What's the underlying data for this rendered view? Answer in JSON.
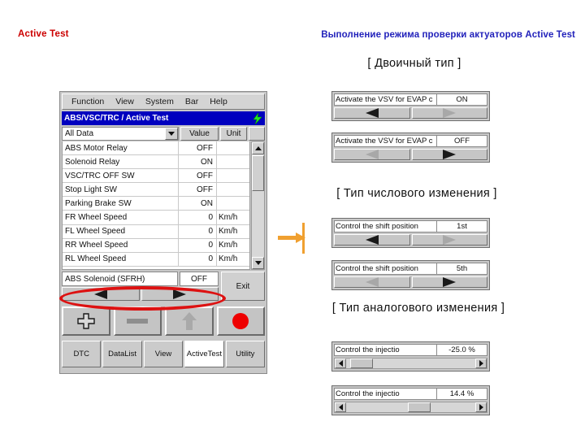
{
  "header": {
    "left_label": "Active Test",
    "right_label": "Выполнение режима проверки актуаторов Active Test",
    "left_color": "#cc0000",
    "right_color": "#2222bb"
  },
  "device": {
    "menu": [
      "Function",
      "View",
      "System",
      "Bar",
      "Help"
    ],
    "title": "ABS/VSC/TRC / Active Test",
    "title_bg": "#0000bf",
    "bolt_icon": "lightning-bolt-icon",
    "filter": {
      "value": "All Data"
    },
    "columns": [
      "Value",
      "Unit"
    ],
    "rows": [
      {
        "name": "ABS Motor Relay",
        "value": "OFF",
        "unit": ""
      },
      {
        "name": "Solenoid Relay",
        "value": "ON",
        "unit": ""
      },
      {
        "name": "VSC/TRC OFF SW",
        "value": "OFF",
        "unit": ""
      },
      {
        "name": "Stop Light SW",
        "value": "OFF",
        "unit": ""
      },
      {
        "name": "Parking Brake SW",
        "value": "ON",
        "unit": ""
      },
      {
        "name": "FR Wheel Speed",
        "value": "0",
        "unit": "Km/h"
      },
      {
        "name": "FL Wheel Speed",
        "value": "0",
        "unit": "Km/h"
      },
      {
        "name": "RR Wheel Speed",
        "value": "0",
        "unit": "Km/h"
      },
      {
        "name": "RL Wheel Speed",
        "value": "0",
        "unit": "Km/h"
      }
    ],
    "selected": {
      "name": "ABS Solenoid (SFRH)",
      "value": "OFF"
    },
    "exit_label": "Exit",
    "arrow_left_icon": "triangle-left-icon",
    "arrow_right_icon": "triangle-right-icon",
    "big_buttons": [
      "plus-icon",
      "minus-icon",
      "up-arrow-icon",
      "record-circle-icon"
    ],
    "record_color": "#ee0000",
    "tabs": [
      {
        "label": "DTC",
        "selected": false
      },
      {
        "label": "Data\nList",
        "line1": "Data",
        "line2": "List",
        "selected": false
      },
      {
        "label": "View",
        "selected": false
      },
      {
        "label": "Active\nTest",
        "line1": "Active",
        "line2": "Test",
        "selected": true
      },
      {
        "label": "Utility",
        "selected": false
      }
    ],
    "highlight_color": "#dd1111"
  },
  "sections": [
    {
      "title": "[ Двоичный тип ]",
      "panels": [
        {
          "name": "Activate the VSV for EVAP c",
          "value": "ON",
          "left_state": "active",
          "right_state": "disabled"
        },
        {
          "name": "Activate the VSV for EVAP c",
          "value": "OFF",
          "left_state": "disabled",
          "right_state": "active"
        }
      ]
    },
    {
      "title": "[ Тип числового изменения ]",
      "panels": [
        {
          "name": "Control the shift position",
          "value": "1st",
          "left_state": "active",
          "right_state": "disabled"
        },
        {
          "name": "Control the shift position",
          "value": "5th",
          "left_state": "disabled",
          "right_state": "active"
        }
      ]
    },
    {
      "title": "[ Тип аналогового изменения ]",
      "panels": [
        {
          "name": "Control the injectio",
          "value": "-25.0 %",
          "thumb_pct": 3
        },
        {
          "name": "Control the injectio",
          "value": "14.4 %",
          "thumb_pct": 50
        }
      ]
    }
  ],
  "connector": {
    "icon": "orange-arrow-icon",
    "color": "#f0a030"
  }
}
